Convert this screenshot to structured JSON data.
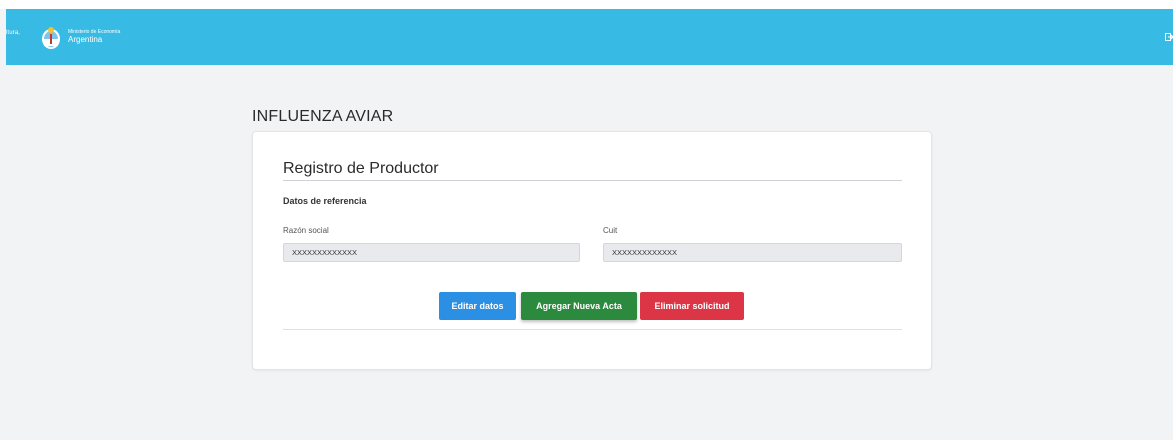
{
  "header": {
    "cut_text": "ltura,",
    "ministry_small": "Ministerio de Economía",
    "ministry_big": "Argentina",
    "logo_icon": "argentina-coat-of-arms-icon",
    "exit_icon": "logout-icon",
    "background_color": "#37bbe4"
  },
  "page": {
    "title": "INFLUENZA AVIAR"
  },
  "card": {
    "title": "Registro de Productor",
    "section_label": "Datos de referencia",
    "fields": [
      {
        "label": "Razón social",
        "value": "XXXXXXXXXXXXX"
      },
      {
        "label": "Cuit",
        "value": "XXXXXXXXXXXXX"
      }
    ],
    "buttons": {
      "edit": "Editar datos",
      "add": "Agregar Nueva Acta",
      "delete": "Eliminar solicitud"
    }
  },
  "colors": {
    "edit_button": "#2b8fe3",
    "add_button": "#2b8a3e",
    "delete_button": "#dc3546"
  }
}
